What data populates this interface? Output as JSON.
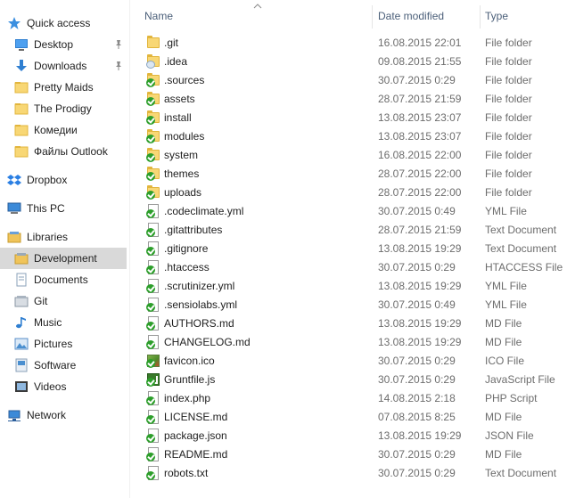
{
  "nav": {
    "items": [
      {
        "label": "Quick access",
        "icon": "star-icon",
        "pinned": false
      },
      {
        "label": "Desktop",
        "icon": "desktop-icon",
        "pinned": true
      },
      {
        "label": "Downloads",
        "icon": "download-arrow-icon",
        "pinned": true
      },
      {
        "label": "Pretty Maids",
        "icon": "folder-icon",
        "pinned": false
      },
      {
        "label": "The Prodigy",
        "icon": "folder-icon",
        "pinned": false
      },
      {
        "label": "Комедии",
        "icon": "folder-icon",
        "pinned": false
      },
      {
        "label": "Файлы Outlook",
        "icon": "folder-icon",
        "pinned": false
      },
      {
        "label": "Dropbox",
        "icon": "dropbox-icon",
        "pinned": false
      },
      {
        "label": "This PC",
        "icon": "computer-icon",
        "pinned": false
      },
      {
        "label": "Libraries",
        "icon": "libraries-icon",
        "pinned": false
      },
      {
        "label": "Development",
        "icon": "library-icon",
        "pinned": false,
        "selected": true
      },
      {
        "label": "Documents",
        "icon": "documents-icon",
        "pinned": false
      },
      {
        "label": "Git",
        "icon": "git-library-icon",
        "pinned": false
      },
      {
        "label": "Music",
        "icon": "music-icon",
        "pinned": false
      },
      {
        "label": "Pictures",
        "icon": "pictures-icon",
        "pinned": false
      },
      {
        "label": "Software",
        "icon": "software-icon",
        "pinned": false
      },
      {
        "label": "Videos",
        "icon": "videos-icon",
        "pinned": false
      },
      {
        "label": "Network",
        "icon": "network-icon",
        "pinned": false
      }
    ]
  },
  "columns": {
    "name": "Name",
    "date": "Date modified",
    "type": "Type"
  },
  "files": [
    {
      "name": ".git",
      "date": "16.08.2015 22:01",
      "type": "File folder",
      "icon": "folder",
      "overlay": "none"
    },
    {
      "name": ".idea",
      "date": "09.08.2015 21:55",
      "type": "File folder",
      "icon": "folder",
      "overlay": "sync"
    },
    {
      "name": ".sources",
      "date": "30.07.2015 0:29",
      "type": "File folder",
      "icon": "folder",
      "overlay": "check"
    },
    {
      "name": "assets",
      "date": "28.07.2015 21:59",
      "type": "File folder",
      "icon": "folder",
      "overlay": "check"
    },
    {
      "name": "install",
      "date": "13.08.2015 23:07",
      "type": "File folder",
      "icon": "folder",
      "overlay": "check"
    },
    {
      "name": "modules",
      "date": "13.08.2015 23:07",
      "type": "File folder",
      "icon": "folder",
      "overlay": "check"
    },
    {
      "name": "system",
      "date": "16.08.2015 22:00",
      "type": "File folder",
      "icon": "folder",
      "overlay": "check"
    },
    {
      "name": "themes",
      "date": "28.07.2015 22:00",
      "type": "File folder",
      "icon": "folder",
      "overlay": "check"
    },
    {
      "name": "uploads",
      "date": "28.07.2015 22:00",
      "type": "File folder",
      "icon": "folder",
      "overlay": "check"
    },
    {
      "name": ".codeclimate.yml",
      "date": "30.07.2015 0:49",
      "type": "YML File",
      "icon": "doc",
      "overlay": "check"
    },
    {
      "name": ".gitattributes",
      "date": "28.07.2015 21:59",
      "type": "Text Document",
      "icon": "doc",
      "overlay": "check"
    },
    {
      "name": ".gitignore",
      "date": "13.08.2015 19:29",
      "type": "Text Document",
      "icon": "doc",
      "overlay": "check"
    },
    {
      "name": ".htaccess",
      "date": "30.07.2015 0:29",
      "type": "HTACCESS File",
      "icon": "doc",
      "overlay": "check"
    },
    {
      "name": ".scrutinizer.yml",
      "date": "13.08.2015 19:29",
      "type": "YML File",
      "icon": "doc",
      "overlay": "check"
    },
    {
      "name": ".sensiolabs.yml",
      "date": "30.07.2015 0:49",
      "type": "YML File",
      "icon": "doc",
      "overlay": "check"
    },
    {
      "name": "AUTHORS.md",
      "date": "13.08.2015 19:29",
      "type": "MD File",
      "icon": "doc",
      "overlay": "check"
    },
    {
      "name": "CHANGELOG.md",
      "date": "13.08.2015 19:29",
      "type": "MD File",
      "icon": "doc",
      "overlay": "check"
    },
    {
      "name": "favicon.ico",
      "date": "30.07.2015 0:29",
      "type": "ICO File",
      "icon": "img",
      "overlay": "check"
    },
    {
      "name": "Gruntfile.js",
      "date": "30.07.2015 0:29",
      "type": "JavaScript File",
      "icon": "js",
      "overlay": "check"
    },
    {
      "name": "index.php",
      "date": "14.08.2015 2:18",
      "type": "PHP Script",
      "icon": "doc",
      "overlay": "check"
    },
    {
      "name": "LICENSE.md",
      "date": "07.08.2015 8:25",
      "type": "MD File",
      "icon": "doc",
      "overlay": "check"
    },
    {
      "name": "package.json",
      "date": "13.08.2015 19:29",
      "type": "JSON File",
      "icon": "doc",
      "overlay": "check"
    },
    {
      "name": "README.md",
      "date": "30.07.2015 0:29",
      "type": "MD File",
      "icon": "doc",
      "overlay": "check"
    },
    {
      "name": "robots.txt",
      "date": "30.07.2015 0:29",
      "type": "Text Document",
      "icon": "doc",
      "overlay": "check"
    }
  ]
}
